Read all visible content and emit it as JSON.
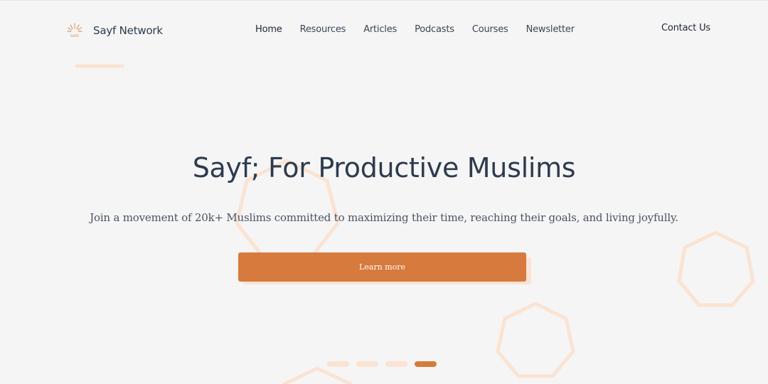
{
  "brand": {
    "name": "Sayf Network",
    "logo_icon": "sun-rays-logo-icon",
    "logo_text": "SAYF"
  },
  "nav": {
    "links": [
      {
        "label": "Home",
        "active": true
      },
      {
        "label": "Resources",
        "active": false
      },
      {
        "label": "Articles",
        "active": false
      },
      {
        "label": "Podcasts",
        "active": false
      },
      {
        "label": "Courses",
        "active": false
      },
      {
        "label": "Newsletter",
        "active": false
      }
    ],
    "contact_label": "Contact Us"
  },
  "hero": {
    "title": "Sayf; For Productive Muslims",
    "subtitle": "Join a movement of 20k+ Muslims committed to maximizing their time, reaching their goals, and living joyfully.",
    "cta_label": "Learn more"
  },
  "carousel": {
    "slide_count": 4,
    "active_index": 3
  },
  "colors": {
    "accent": "#d77a3d",
    "accent_light": "#fbe3d3",
    "heading": "#2d3b4e",
    "background": "#f5f5f5"
  }
}
